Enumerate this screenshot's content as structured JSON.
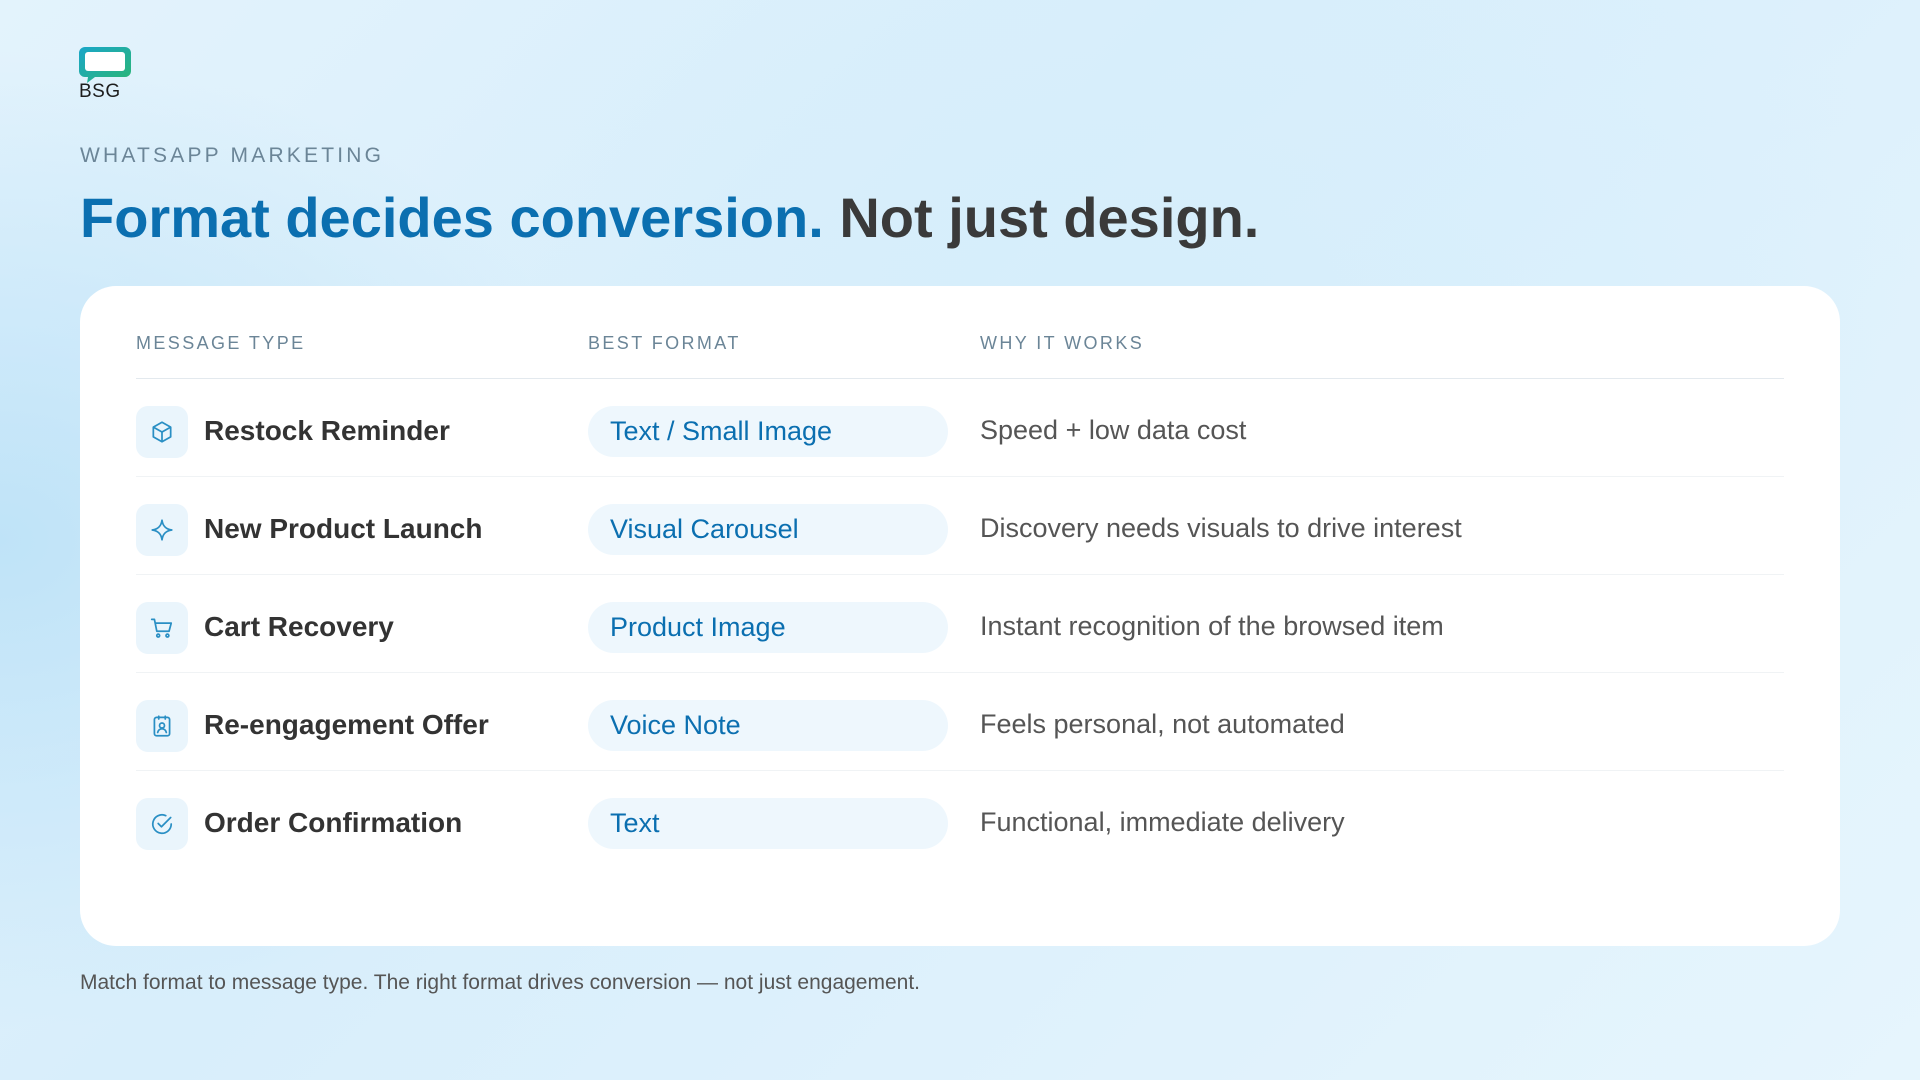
{
  "brand": {
    "logo_text": "BSG"
  },
  "header": {
    "eyebrow": "WHATSAPP MARKETING",
    "headline_accent": "Format decides conversion.",
    "headline_rest": "Not just design."
  },
  "table": {
    "columns": [
      "MESSAGE TYPE",
      "BEST FORMAT",
      "WHY IT WORKS"
    ],
    "rows": [
      {
        "icon": "box-icon",
        "type": "Restock Reminder",
        "format": "Text / Small Image",
        "why": "Speed + low data cost"
      },
      {
        "icon": "sparkle-icon",
        "type": "New Product Launch",
        "format": "Visual Carousel",
        "why": "Discovery needs visuals to drive interest"
      },
      {
        "icon": "cart-icon",
        "type": "Cart Recovery",
        "format": "Product Image",
        "why": "Instant recognition of the browsed item"
      },
      {
        "icon": "contact-card-icon",
        "type": "Re-engagement Offer",
        "format": "Voice Note",
        "why": "Feels personal, not automated"
      },
      {
        "icon": "check-circle-icon",
        "type": "Order Confirmation",
        "format": "Text",
        "why": "Functional, immediate delivery"
      }
    ]
  },
  "footer": {
    "note": "Match format to message type. The right format drives conversion — not just engagement."
  },
  "colors": {
    "accent": "#0b6fb0",
    "heading_dark": "#3a3a3a",
    "muted": "#6b8597",
    "logo_gradient_start": "#1aa6c9",
    "logo_gradient_end": "#2bb673"
  }
}
